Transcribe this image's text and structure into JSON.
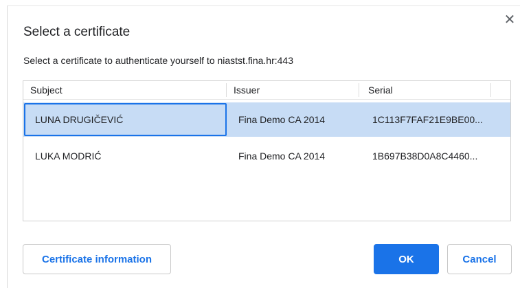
{
  "dialog": {
    "title": "Select a certificate",
    "subtitle": "Select a certificate to authenticate yourself to niastst.fina.hr:443",
    "close_icon": "close-icon"
  },
  "table": {
    "columns": [
      "Subject",
      "Issuer",
      "Serial"
    ],
    "rows": [
      {
        "subject": "LUNA DRUGIČEVIĆ",
        "issuer": "Fina Demo CA 2014",
        "serial": "1C113F7FAF21E9BE00...",
        "selected": true
      },
      {
        "subject": "LUKA MODRIĆ",
        "issuer": "Fina Demo CA 2014",
        "serial": "1B697B38D0A8C4460...",
        "selected": false
      }
    ]
  },
  "buttons": {
    "info": "Certificate information",
    "ok": "OK",
    "cancel": "Cancel"
  },
  "colors": {
    "accent": "#1a73e8",
    "selection": "#c7dcf5"
  }
}
